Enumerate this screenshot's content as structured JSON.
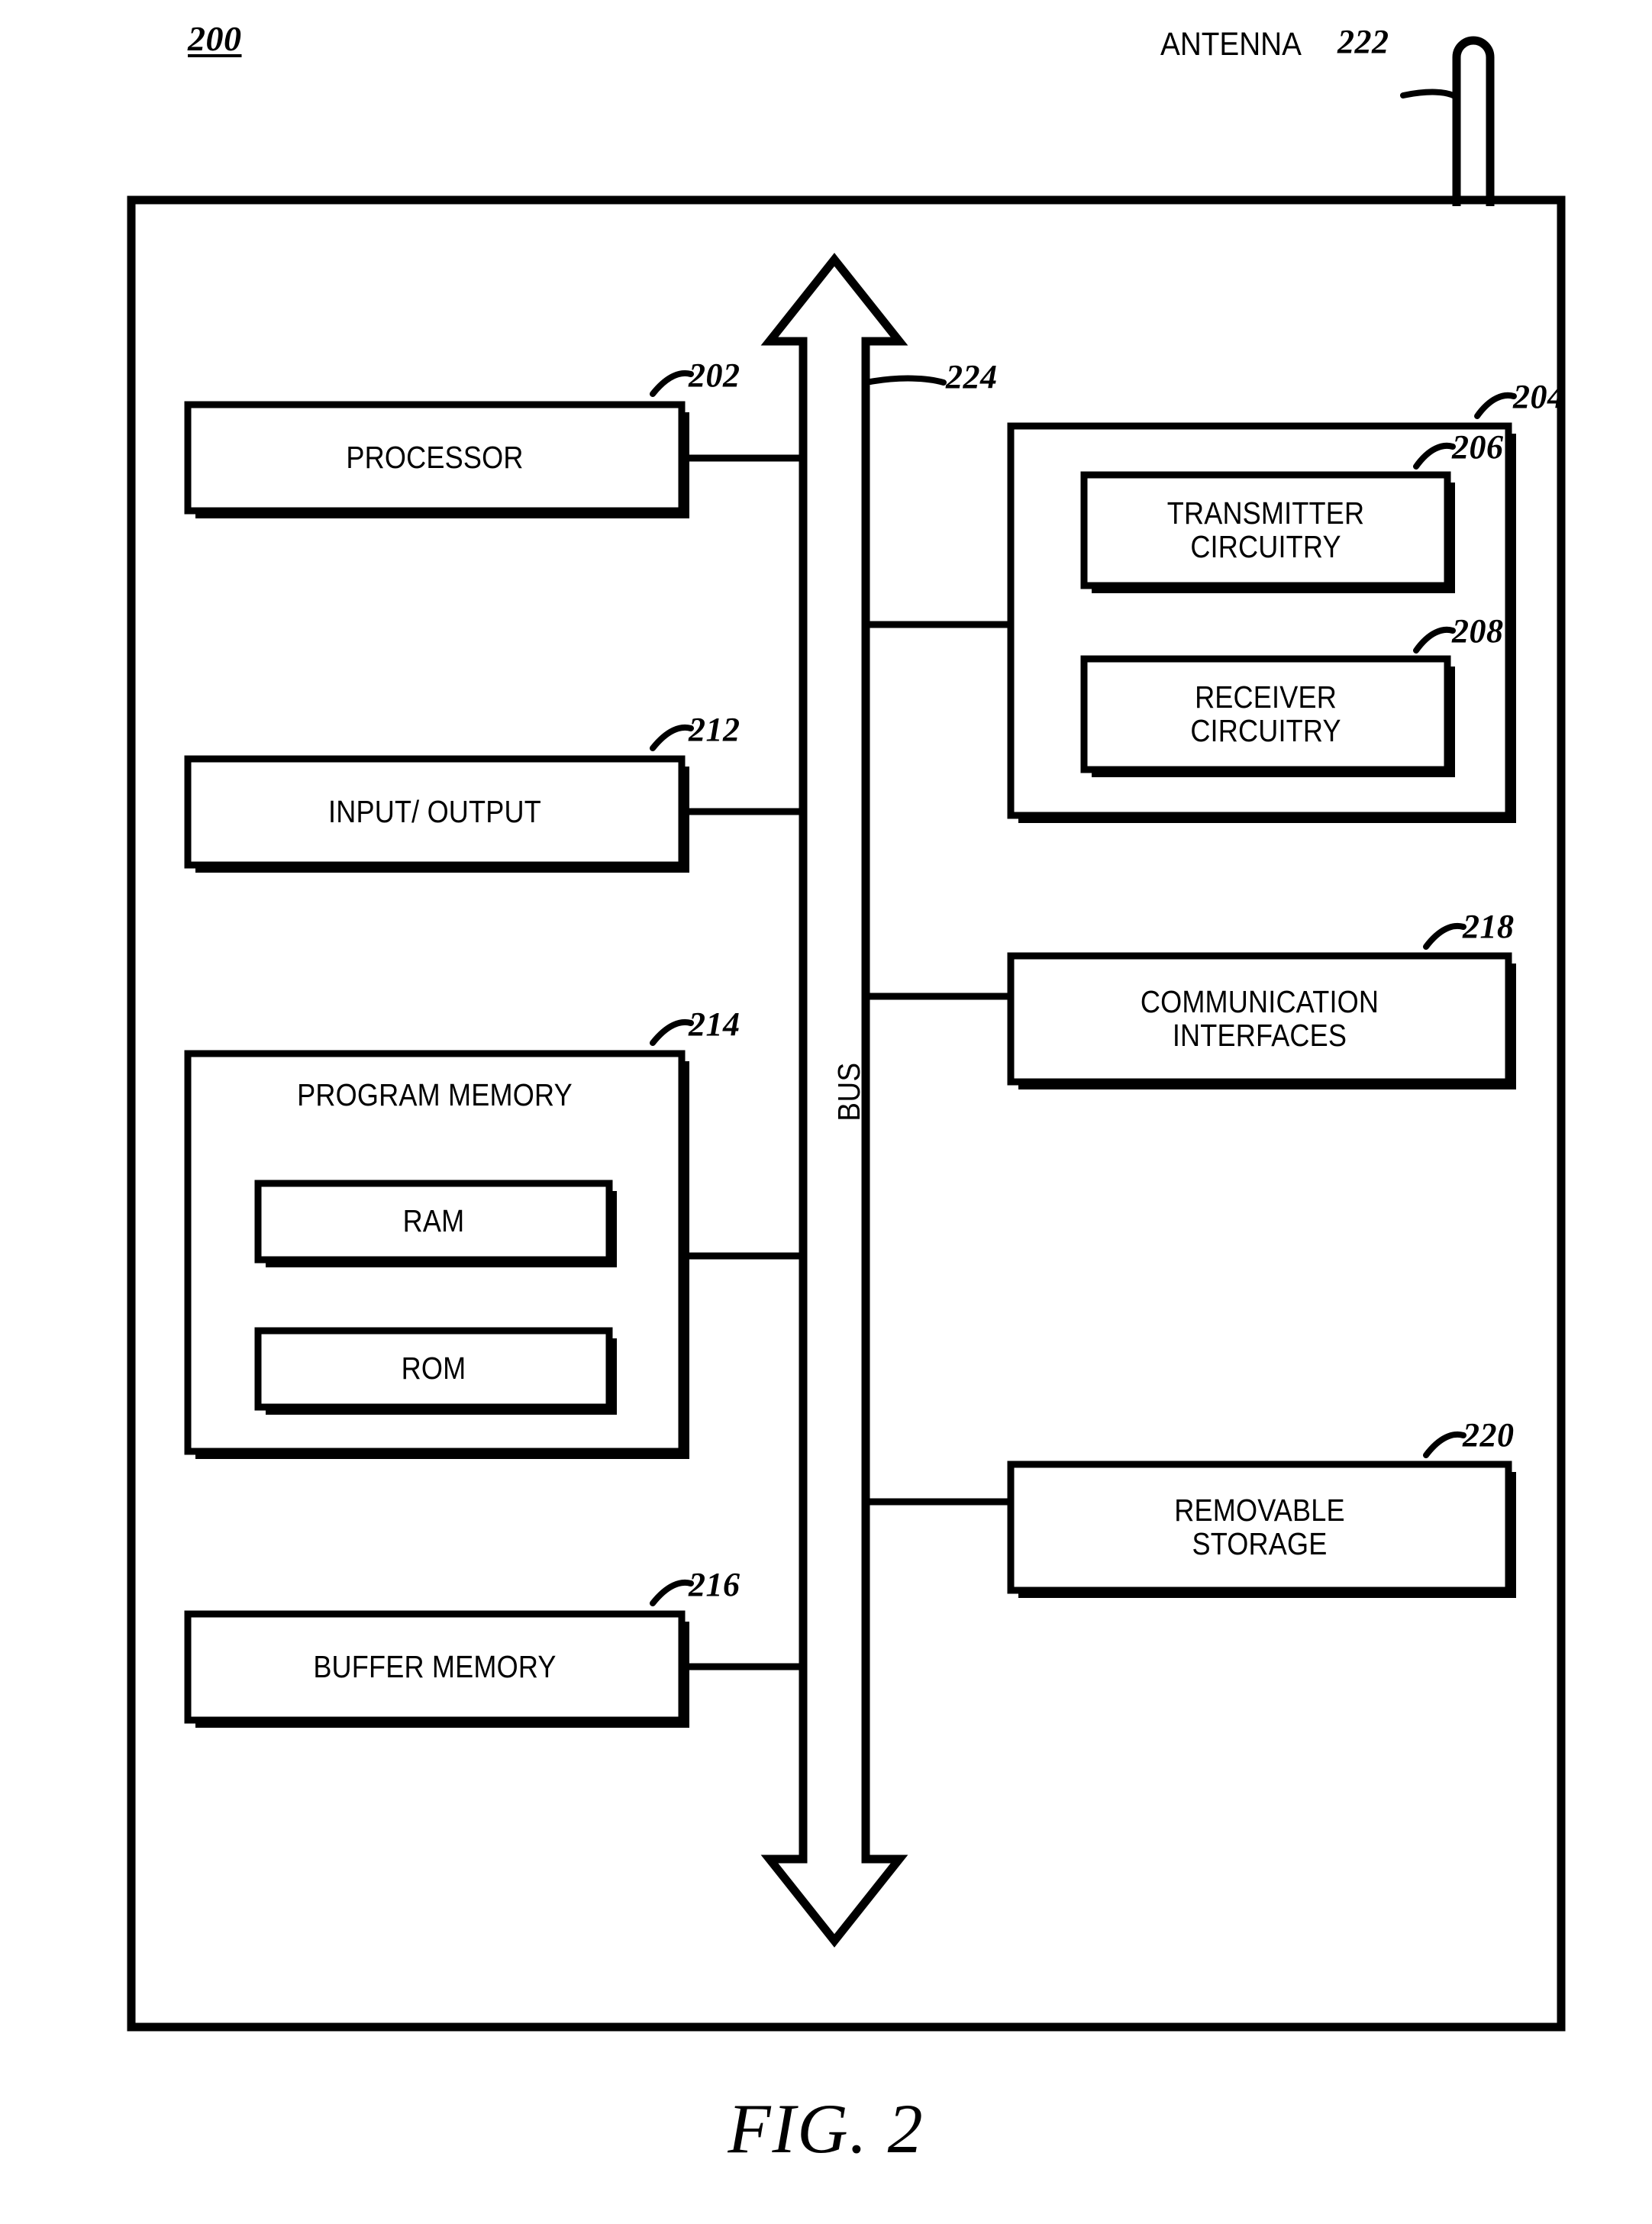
{
  "figure": {
    "id_label": "200",
    "caption": "FIG. 2",
    "antenna_label": "ANTENNA",
    "antenna_ref": "222",
    "bus_label": "BUS",
    "bus_ref": "224"
  },
  "blocks": [
    {
      "key": "processor",
      "label": "PROCESSOR",
      "ref": "202"
    },
    {
      "key": "input_output",
      "label": "INPUT/ OUTPUT",
      "ref": "212"
    },
    {
      "key": "program_memory",
      "label": "PROGRAM MEMORY",
      "ref": "214"
    },
    {
      "key": "ram",
      "label": "RAM",
      "ref": ""
    },
    {
      "key": "rom",
      "label": "ROM",
      "ref": ""
    },
    {
      "key": "buffer_memory",
      "label": "BUFFER MEMORY",
      "ref": "216"
    },
    {
      "key": "radio",
      "label": "",
      "ref": "204"
    },
    {
      "key": "transmitter",
      "label_line1": "TRANSMITTER",
      "label_line2": "CIRCUITRY",
      "ref": "206"
    },
    {
      "key": "receiver",
      "label_line1": "RECEIVER",
      "label_line2": "CIRCUITRY",
      "ref": "208"
    },
    {
      "key": "comm_interfaces",
      "label_line1": "COMMUNICATION",
      "label_line2": "INTERFACES",
      "ref": "218"
    },
    {
      "key": "removable",
      "label_line1": "REMOVABLE",
      "label_line2": "STORAGE",
      "ref": "220"
    }
  ],
  "text": {
    "processor": "PROCESSOR",
    "input_output": "INPUT/ OUTPUT",
    "program_memory": "PROGRAM MEMORY",
    "ram": "RAM",
    "rom": "ROM",
    "buffer_memory": "BUFFER MEMORY",
    "transmitter_l1": "TRANSMITTER",
    "transmitter_l2": "CIRCUITRY",
    "receiver_l1": "RECEIVER",
    "receiver_l2": "CIRCUITRY",
    "comm_l1": "COMMUNICATION",
    "comm_l2": "INTERFACES",
    "removable_l1": "REMOVABLE",
    "removable_l2": "STORAGE"
  },
  "refs": {
    "r200": "200",
    "r202": "202",
    "r204": "204",
    "r206": "206",
    "r208": "208",
    "r212": "212",
    "r214": "214",
    "r216": "216",
    "r218": "218",
    "r220": "220",
    "r222": "222",
    "r224": "224"
  },
  "colors": {
    "ink": "#000000",
    "paper": "#ffffff"
  }
}
